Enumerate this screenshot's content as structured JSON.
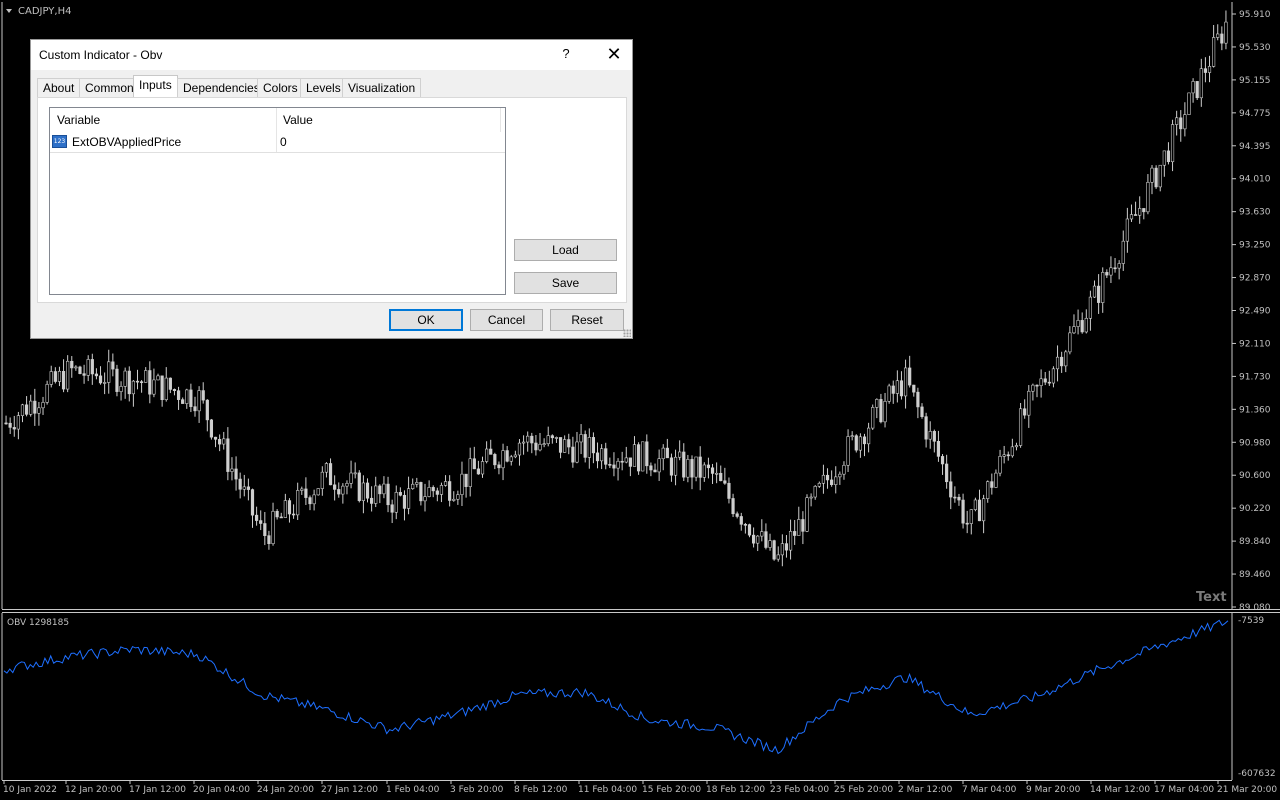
{
  "chart": {
    "symbol_label": "CADJPY,H4",
    "watermark": "Text",
    "indicator_label": "OBV 1298185",
    "price_axis": [
      "95.910",
      "95.530",
      "95.155",
      "94.775",
      "94.395",
      "94.010",
      "93.630",
      "93.250",
      "92.870",
      "92.490",
      "92.110",
      "91.730",
      "91.360",
      "90.980",
      "90.600",
      "90.220",
      "89.840",
      "89.460",
      "89.080"
    ],
    "obv_axis_top": "-7539",
    "obv_axis_bottom": "-607632",
    "time_axis": [
      "10 Jan 2022",
      "12 Jan 20:00",
      "17 Jan 12:00",
      "20 Jan 04:00",
      "24 Jan 20:00",
      "27 Jan 12:00",
      "1 Feb 04:00",
      "3 Feb 20:00",
      "8 Feb 12:00",
      "11 Feb 04:00",
      "15 Feb 20:00",
      "18 Feb 12:00",
      "23 Feb 04:00",
      "25 Feb 20:00",
      "2 Mar 12:00",
      "7 Mar 04:00",
      "9 Mar 20:00",
      "14 Mar 12:00",
      "17 Mar 04:00",
      "21 Mar 20:00"
    ],
    "colors": {
      "background": "#000000",
      "candle": "#cfcfcf",
      "obv_line": "#1e6fff",
      "axis_text": "#c0c0c0",
      "separator": "#c8c8c8"
    }
  },
  "chart_data": {
    "type": "line",
    "title": "CADJPY,H4",
    "xlabel": "",
    "ylabel": "",
    "ylim": [
      89.08,
      95.91
    ],
    "x": [
      "10 Jan 2022",
      "12 Jan 20:00",
      "17 Jan 12:00",
      "20 Jan 04:00",
      "24 Jan 20:00",
      "27 Jan 12:00",
      "1 Feb 04:00",
      "3 Feb 20:00",
      "8 Feb 12:00",
      "11 Feb 04:00",
      "15 Feb 20:00",
      "18 Feb 12:00",
      "23 Feb 04:00",
      "25 Feb 20:00",
      "2 Mar 12:00",
      "7 Mar 04:00",
      "9 Mar 20:00",
      "14 Mar 12:00",
      "17 Mar 04:00",
      "21 Mar 20:00"
    ],
    "series": [
      {
        "name": "CADJPY,H4",
        "values": [
          91.2,
          91.8,
          91.7,
          91.5,
          89.9,
          90.6,
          90.3,
          90.5,
          91.0,
          90.9,
          90.8,
          90.6,
          89.6,
          90.8,
          91.7,
          90.0,
          91.5,
          92.7,
          94.2,
          95.8
        ]
      },
      {
        "name": "OBV 1298185",
        "values": [
          -200000,
          -150000,
          -120000,
          -140000,
          -300000,
          -360000,
          -440000,
          -380000,
          -300000,
          -290000,
          -400000,
          -430000,
          -520000,
          -320000,
          -230000,
          -380000,
          -310000,
          -200000,
          -100000,
          -7539
        ]
      }
    ]
  },
  "dialog": {
    "title": "Custom Indicator - Obv",
    "help_label": "?",
    "close_label": "✕",
    "tabs": [
      "About",
      "Common",
      "Inputs",
      "Dependencies",
      "Colors",
      "Levels",
      "Visualization"
    ],
    "active_tab": "Inputs",
    "table": {
      "columns": [
        "Variable",
        "Value"
      ],
      "rows": [
        {
          "variable": "ExtOBVAppliedPrice",
          "value": "0",
          "icon": "integer-param-icon",
          "icon_text": "123"
        }
      ]
    },
    "load_label": "Load",
    "save_label": "Save",
    "ok_label": "OK",
    "cancel_label": "Cancel",
    "reset_label": "Reset"
  }
}
